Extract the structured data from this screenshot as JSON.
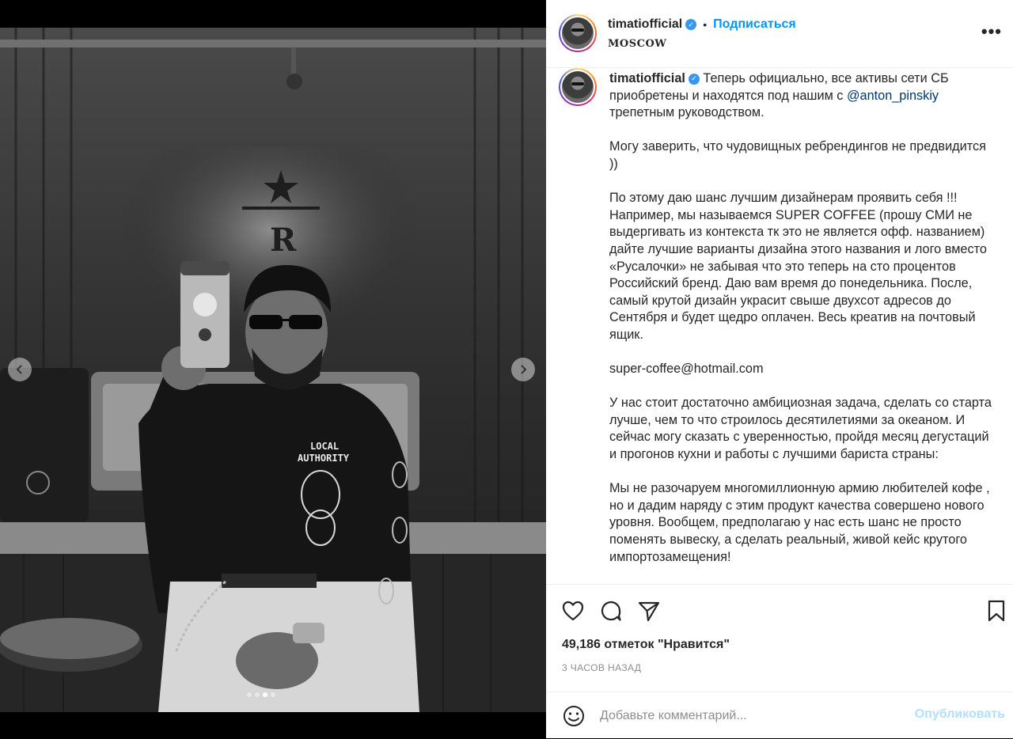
{
  "post": {
    "username": "timatiofficial",
    "verified": true,
    "follow_label": "Подписаться",
    "location": "MOSCOW",
    "more_label": "•••",
    "caption": {
      "lead": " Теперь официально, все активы сети СБ приобретены и находятся под нашим с ",
      "mention": "@anton_pinskiy",
      "lead_end": " трепетным руководством.",
      "paragraphs": [
        "Могу заверить, что чудовищных ребрендингов не предвидится ))",
        "По этому даю шанс лучшим дизайнерам проявить себя !!! Например, мы называемся SUPER COFFEE (прошу СМИ не выдергивать из контекста тк это не является офф. названием) дайте лучшие варианты дизайна этого названия и лого вместо «Русалочки» не забывая что это теперь на сто процентов Российский бренд. Даю вам время до понедельника. После, самый крутой дизайн украсит свыше двухсот адресов до Сентября и будет щедро оплачен. Весь креатив на почтовый ящик.",
        "super-coffee@hotmail.com",
        "У нас стоит достаточно амбициозная задача, сделать со старта лучше, чем то что строилось десятилетиями за океаном. И сейчас могу сказать с уверенностью, пройдя месяц дегустаций и прогонов кухни и работы с лучшими бариста страны:",
        "Мы не разочаруем многомиллионную армию любителей кофе , но и дадим наряду с этим продукт качества совершено нового уровня. Вообщем, предполагаю у нас есть шанс не просто поменять вывеску, а сделать реальный, живой кейс крутого импортозамещения!"
      ]
    },
    "likes": "49,186 отметок \"Нравится\"",
    "time": "3 ЧАСОВ НАЗАД",
    "comment_placeholder": "Добавьте комментарий...",
    "publish_label": "Опубликовать",
    "carousel": {
      "total": 4,
      "active_index": 2
    }
  },
  "icons": [
    "heart-icon",
    "comment-icon",
    "share-icon",
    "bookmark-icon",
    "emoji-icon",
    "chevron-left-icon",
    "chevron-right-icon",
    "verified-icon"
  ],
  "colors": {
    "accent": "#0095f6",
    "publish_disabled": "#b2dffc",
    "mention": "#00376b",
    "muted": "#8e8e8e"
  }
}
